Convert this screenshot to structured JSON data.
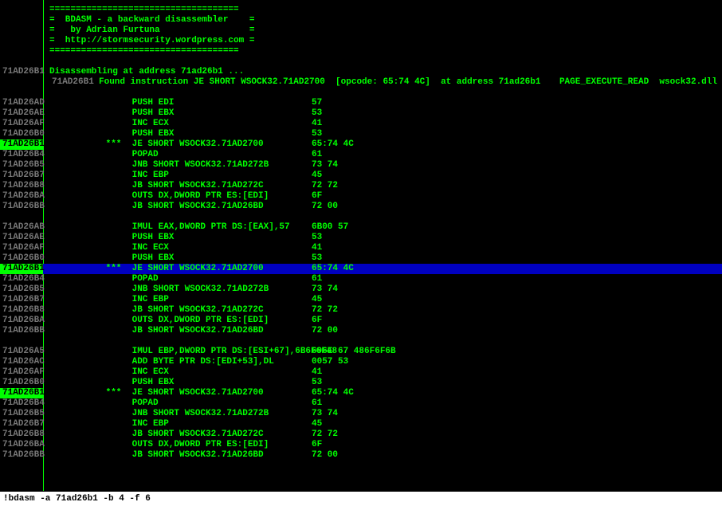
{
  "banner": {
    "rule": "====================================",
    "l1": "=  BDASM - a backward disassembler    =",
    "l2": "=   by Adrian Furtuna                 =",
    "l3": "=  http://stormsecurity.wordpress.com =",
    "l4": "===================================="
  },
  "banner_addr": [
    "71AD26B1",
    "71AD26B1"
  ],
  "msg": {
    "disasm": "Disassembling at address 71ad26b1 ...",
    "found": "Found instruction JE SHORT WSOCK32.71AD2700  [opcode: 65:74 4C]  at address 71ad26b1",
    "right": "PAGE_EXECUTE_READ  wsock32.dll"
  },
  "groups": [
    {
      "rows": [
        {
          "addr": "71AD26AD",
          "marker": "",
          "instr": "PUSH EDI",
          "bytes": "57"
        },
        {
          "addr": "71AD26AE",
          "marker": "",
          "instr": "PUSH EBX",
          "bytes": "53"
        },
        {
          "addr": "71AD26AF",
          "marker": "",
          "instr": "INC ECX",
          "bytes": "41"
        },
        {
          "addr": "71AD26B0",
          "marker": "",
          "instr": "PUSH EBX",
          "bytes": "53"
        },
        {
          "addr": "71AD26B1",
          "marker": "*** ",
          "instr": "JE SHORT WSOCK32.71AD2700",
          "bytes": "65:74 4C",
          "hl": false,
          "addrHl": true
        },
        {
          "addr": "71AD26B4",
          "marker": "",
          "instr": "POPAD",
          "bytes": "61"
        },
        {
          "addr": "71AD26B5",
          "marker": "",
          "instr": "JNB SHORT WSOCK32.71AD272B",
          "bytes": "73 74"
        },
        {
          "addr": "71AD26B7",
          "marker": "",
          "instr": "INC EBP",
          "bytes": "45"
        },
        {
          "addr": "71AD26B8",
          "marker": "",
          "instr": "JB SHORT WSOCK32.71AD272C",
          "bytes": "72 72"
        },
        {
          "addr": "71AD26BA",
          "marker": "",
          "instr": "OUTS DX,DWORD PTR ES:[EDI]",
          "bytes": "6F"
        },
        {
          "addr": "71AD26BB",
          "marker": "",
          "instr": "JB SHORT WSOCK32.71AD26BD",
          "bytes": "72 00"
        }
      ]
    },
    {
      "rows": [
        {
          "addr": "71AD26AB",
          "marker": "",
          "instr": "IMUL EAX,DWORD PTR DS:[EAX],57",
          "bytes": "6B00 57"
        },
        {
          "addr": "71AD26AE",
          "marker": "",
          "instr": "PUSH EBX",
          "bytes": "53"
        },
        {
          "addr": "71AD26AF",
          "marker": "",
          "instr": "INC ECX",
          "bytes": "41"
        },
        {
          "addr": "71AD26B0",
          "marker": "",
          "instr": "PUSH EBX",
          "bytes": "53"
        },
        {
          "addr": "71AD26B1",
          "marker": "*** ",
          "instr": "JE SHORT WSOCK32.71AD2700",
          "bytes": "65:74 4C",
          "hl": true,
          "addrHl": true
        },
        {
          "addr": "71AD26B4",
          "marker": "",
          "instr": "POPAD",
          "bytes": "61"
        },
        {
          "addr": "71AD26B5",
          "marker": "",
          "instr": "JNB SHORT WSOCK32.71AD272B",
          "bytes": "73 74"
        },
        {
          "addr": "71AD26B7",
          "marker": "",
          "instr": "INC EBP",
          "bytes": "45"
        },
        {
          "addr": "71AD26B8",
          "marker": "",
          "instr": "JB SHORT WSOCK32.71AD272C",
          "bytes": "72 72"
        },
        {
          "addr": "71AD26BA",
          "marker": "",
          "instr": "OUTS DX,DWORD PTR ES:[EDI]",
          "bytes": "6F"
        },
        {
          "addr": "71AD26BB",
          "marker": "",
          "instr": "JB SHORT WSOCK32.71AD26BD",
          "bytes": "72 00"
        }
      ]
    },
    {
      "rows": [
        {
          "addr": "71AD26A5",
          "marker": "",
          "instr": "IMUL EBP,DWORD PTR DS:[ESI+67],6B6F6F48",
          "bytes": "696E 67 486F6F6B"
        },
        {
          "addr": "71AD26AC",
          "marker": "",
          "instr": "ADD BYTE PTR DS:[EDI+53],DL",
          "bytes": "0057 53"
        },
        {
          "addr": "71AD26AF",
          "marker": "",
          "instr": "INC ECX",
          "bytes": "41"
        },
        {
          "addr": "71AD26B0",
          "marker": "",
          "instr": "PUSH EBX",
          "bytes": "53"
        },
        {
          "addr": "71AD26B1",
          "marker": "*** ",
          "instr": "JE SHORT WSOCK32.71AD2700",
          "bytes": "65:74 4C",
          "hl": false,
          "addrHl": true
        },
        {
          "addr": "71AD26B4",
          "marker": "",
          "instr": "POPAD",
          "bytes": "61"
        },
        {
          "addr": "71AD26B5",
          "marker": "",
          "instr": "JNB SHORT WSOCK32.71AD272B",
          "bytes": "73 74"
        },
        {
          "addr": "71AD26B7",
          "marker": "",
          "instr": "INC EBP",
          "bytes": "45"
        },
        {
          "addr": "71AD26B8",
          "marker": "",
          "instr": "JB SHORT WSOCK32.71AD272C",
          "bytes": "72 72"
        },
        {
          "addr": "71AD26BA",
          "marker": "",
          "instr": "OUTS DX,DWORD PTR ES:[EDI]",
          "bytes": "6F"
        },
        {
          "addr": "71AD26BB",
          "marker": "",
          "instr": "JB SHORT WSOCK32.71AD26BD",
          "bytes": "72 00"
        }
      ]
    }
  ],
  "command": "!bdasm -a 71ad26b1 -b 4 -f 6"
}
